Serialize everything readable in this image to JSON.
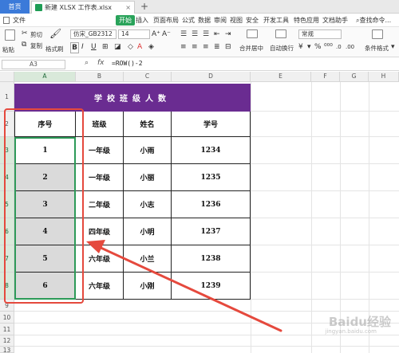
{
  "titlebar": {
    "home_tab": "首页",
    "file_tab": "新建 XLSX 工作表.xlsx",
    "close_glyph": "×",
    "add_glyph": "+"
  },
  "menubar": {
    "items": [
      "文件",
      "开始",
      "插入",
      "页面布局",
      "公式",
      "数据",
      "审阅",
      "视图",
      "安全",
      "开发工具",
      "特色应用",
      "文档助手"
    ],
    "active": "开始",
    "search": "查找命令..."
  },
  "ribbon": {
    "paste": "粘贴",
    "cut": "剪切",
    "copy": "复制",
    "format_painter": "格式刷",
    "font_name": "仿宋_GB2312",
    "font_size": "14",
    "merge_center": "合并居中",
    "wrap_text": "自动换行",
    "number_format": "常规",
    "conditional_format": "条件格式"
  },
  "formula_bar": {
    "name_box": "A3",
    "fx": "fx",
    "formula": "=ROW()-2"
  },
  "columns": [
    "A",
    "B",
    "C",
    "D",
    "E",
    "F",
    "G",
    "H"
  ],
  "rows": [
    "1",
    "2",
    "3",
    "4",
    "5",
    "6",
    "7",
    "8",
    "9",
    "10",
    "11",
    "12",
    "13"
  ],
  "table": {
    "title": "学校班级人数",
    "headers": [
      "序号",
      "班级",
      "姓名",
      "学号"
    ],
    "rows": [
      [
        "1",
        "一年级",
        "小雨",
        "1234"
      ],
      [
        "2",
        "一年级",
        "小丽",
        "1235"
      ],
      [
        "3",
        "二年级",
        "小志",
        "1236"
      ],
      [
        "4",
        "四年级",
        "小明",
        "1237"
      ],
      [
        "5",
        "六年级",
        "小兰",
        "1238"
      ],
      [
        "6",
        "六年级",
        "小刚",
        "1239"
      ]
    ]
  },
  "watermark": "Baidu经验",
  "watermark_sub": "jingyan.baidu.com",
  "colors": {
    "title_fill": "#6a2c91",
    "selection": "#2d9a58",
    "annotation": "#e5493d",
    "accent": "#29a35a"
  }
}
